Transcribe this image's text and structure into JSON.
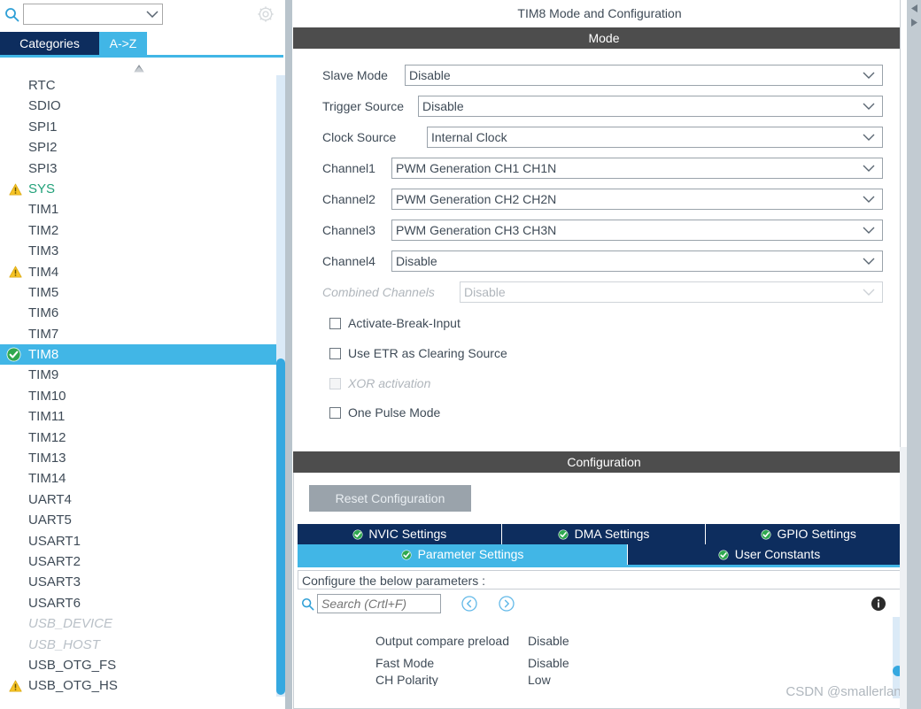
{
  "left_panel": {
    "search": {
      "value": "",
      "placeholder": ""
    },
    "gear_icon": "gear-icon",
    "search_icon": "search-icon",
    "tabs": [
      {
        "label": "Categories",
        "active": false
      },
      {
        "label": "A->Z",
        "active": true
      }
    ],
    "components": [
      {
        "label": "RTC",
        "state": "normal"
      },
      {
        "label": "SDIO",
        "state": "normal"
      },
      {
        "label": "SPI1",
        "state": "normal"
      },
      {
        "label": "SPI2",
        "state": "normal"
      },
      {
        "label": "SPI3",
        "state": "normal"
      },
      {
        "label": "SYS",
        "state": "warning-green",
        "icon": "warning-triangle-icon"
      },
      {
        "label": "TIM1",
        "state": "normal"
      },
      {
        "label": "TIM2",
        "state": "normal"
      },
      {
        "label": "TIM3",
        "state": "normal"
      },
      {
        "label": "TIM4",
        "state": "warning",
        "icon": "warning-triangle-icon"
      },
      {
        "label": "TIM5",
        "state": "normal"
      },
      {
        "label": "TIM6",
        "state": "normal"
      },
      {
        "label": "TIM7",
        "state": "normal"
      },
      {
        "label": "TIM8",
        "state": "selected",
        "icon": "check-circle-icon"
      },
      {
        "label": "TIM9",
        "state": "normal"
      },
      {
        "label": "TIM10",
        "state": "normal"
      },
      {
        "label": "TIM11",
        "state": "normal"
      },
      {
        "label": "TIM12",
        "state": "normal"
      },
      {
        "label": "TIM13",
        "state": "normal"
      },
      {
        "label": "TIM14",
        "state": "normal"
      },
      {
        "label": "UART4",
        "state": "normal"
      },
      {
        "label": "UART5",
        "state": "normal"
      },
      {
        "label": "USART1",
        "state": "normal"
      },
      {
        "label": "USART2",
        "state": "normal"
      },
      {
        "label": "USART3",
        "state": "normal"
      },
      {
        "label": "USART6",
        "state": "normal"
      },
      {
        "label": "USB_DEVICE",
        "state": "disabled"
      },
      {
        "label": "USB_HOST",
        "state": "disabled"
      },
      {
        "label": "USB_OTG_FS",
        "state": "normal"
      },
      {
        "label": "USB_OTG_HS",
        "state": "warning",
        "icon": "warning-triangle-icon"
      }
    ]
  },
  "right_panel": {
    "title": "TIM8 Mode and Configuration",
    "mode_section": {
      "header": "Mode",
      "fields": [
        {
          "label": "Slave Mode",
          "value": "Disable",
          "disabled": false
        },
        {
          "label": "Trigger Source",
          "value": "Disable",
          "disabled": false
        },
        {
          "label": "Clock Source",
          "value": "Internal Clock",
          "disabled": false
        },
        {
          "label": "Channel1",
          "value": "PWM Generation CH1 CH1N",
          "disabled": false
        },
        {
          "label": "Channel2",
          "value": "PWM Generation CH2 CH2N",
          "disabled": false
        },
        {
          "label": "Channel3",
          "value": "PWM Generation CH3 CH3N",
          "disabled": false
        },
        {
          "label": "Channel4",
          "value": "Disable",
          "disabled": false
        },
        {
          "label": "Combined Channels",
          "value": "Disable",
          "disabled": true
        }
      ],
      "checkboxes": [
        {
          "label": "Activate-Break-Input",
          "checked": false,
          "disabled": false
        },
        {
          "label": "Use ETR as Clearing Source",
          "checked": false,
          "disabled": false
        },
        {
          "label": "XOR activation",
          "checked": false,
          "disabled": true
        },
        {
          "label": "One Pulse Mode",
          "checked": false,
          "disabled": false
        }
      ]
    },
    "config_section": {
      "header": "Configuration",
      "reset_button": "Reset Configuration",
      "tabs_row1": [
        {
          "label": "NVIC Settings",
          "active": false
        },
        {
          "label": "DMA Settings",
          "active": false
        },
        {
          "label": "GPIO Settings",
          "active": false
        }
      ],
      "tabs_row2": [
        {
          "label": "Parameter Settings",
          "active": true
        },
        {
          "label": "User Constants",
          "active": false
        }
      ],
      "hint": "Configure the below parameters :",
      "search": {
        "value": "",
        "placeholder": "Search (Crtl+F)"
      },
      "nav_prev_icon": "chevron-left-circle-icon",
      "nav_next_icon": "chevron-right-circle-icon",
      "info_icon": "info-icon",
      "params": [
        {
          "name": "Output compare preload",
          "value": "Disable"
        },
        {
          "name": "Fast Mode",
          "value": "Disable"
        },
        {
          "name": "CH Polarity",
          "value": "Low"
        }
      ]
    }
  },
  "watermark": "CSDN @smallerlang",
  "colors": {
    "accent_blue": "#41b6e6",
    "navy": "#0d2d5e",
    "header_gray": "#4d4d4d",
    "text": "#3f4b57",
    "green": "#21a179",
    "warning": "#f5c026",
    "disabled": "#b0b6bc"
  }
}
